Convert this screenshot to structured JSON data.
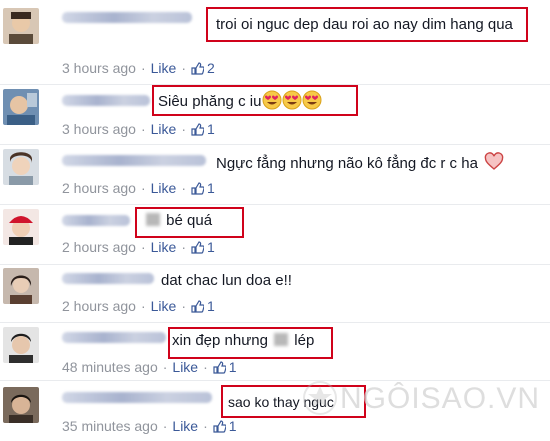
{
  "comments": [
    {
      "text": "troi oi nguc dep dau roi ao nay dim hang qua",
      "time": "3 hours ago",
      "like": "Like",
      "likes": "2"
    },
    {
      "text": "Siêu phăng c iu",
      "time": "3 hours ago",
      "like": "Like",
      "likes": "1"
    },
    {
      "text": "Ngực fẳng nhưng não kô fẳng đc r c ha",
      "time": "2 hours ago",
      "like": "Like",
      "likes": "1"
    },
    {
      "text_pre": "",
      "text_post": "bé quá",
      "time": "2 hours ago",
      "like": "Like",
      "likes": "1"
    },
    {
      "text": "dat chac lun doa e!!",
      "time": "2 hours ago",
      "like": "Like",
      "likes": "1"
    },
    {
      "text_pre": "xin đẹp nhưng",
      "text_post": "lép",
      "time": "48 minutes ago",
      "like": "Like",
      "likes": "1"
    },
    {
      "text": "sao ko thay nguc",
      "time": "35 minutes ago",
      "like": "Like",
      "likes": "1"
    }
  ],
  "separator": "·",
  "icons": {
    "like_count": "thumbs-up-icon",
    "emoji": "heart-eyes-emoji-icon",
    "heart": "heart-icon"
  },
  "watermark": "NGÔISAO.VN",
  "colors": {
    "highlight": "#d0021b",
    "link": "#3b5998",
    "meta": "#90949c"
  }
}
